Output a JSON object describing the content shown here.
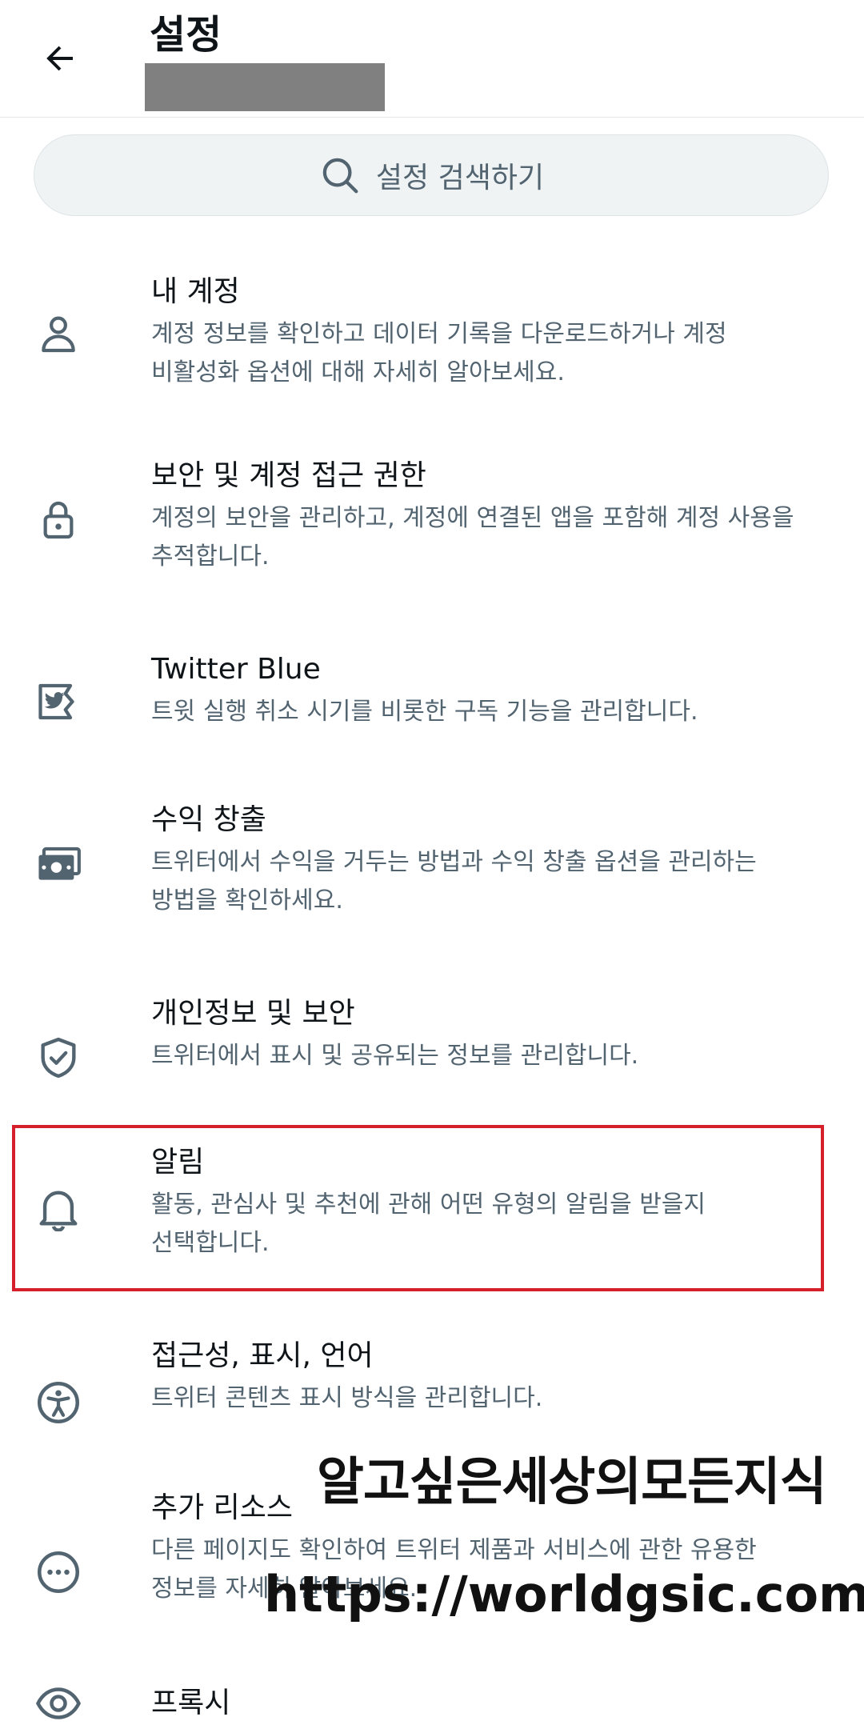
{
  "header": {
    "title": "설정",
    "back_icon": "arrow-left-icon"
  },
  "search": {
    "placeholder": "설정 검색하기",
    "icon": "search-icon"
  },
  "items": [
    {
      "icon": "person-icon",
      "title": "내 계정",
      "desc": [
        "계정 정보를 확인하고 데이터 기록을 다운로드하거나 계정",
        "비활성화 옵션에 대해 자세히 알아보세요."
      ]
    },
    {
      "icon": "lock-icon",
      "title": "보안 및 계정 접근 권한",
      "desc": [
        "계정의 보안을 관리하고, 계정에 연결된 앱을 포함해 계정 사용을",
        "추적합니다."
      ]
    },
    {
      "icon": "twitter-blue-icon",
      "title": "Twitter Blue",
      "desc": [
        "트윗 실행 취소 시기를 비롯한 구독 기능을 관리합니다."
      ]
    },
    {
      "icon": "money-icon",
      "title": "수익 창출",
      "desc": [
        "트위터에서 수익을 거두는 방법과 수익 창출 옵션을 관리하는",
        "방법을 확인하세요."
      ]
    },
    {
      "icon": "shield-check-icon",
      "title": "개인정보 및 보안",
      "desc": [
        "트위터에서 표시 및 공유되는 정보를 관리합니다."
      ]
    },
    {
      "icon": "bell-icon",
      "title": "알림",
      "desc": [
        "활동, 관심사 및 추천에 관해 어떤 유형의 알림을 받을지",
        "선택합니다."
      ]
    },
    {
      "icon": "accessibility-icon",
      "title": "접근성, 표시, 언어",
      "desc": [
        "트위터 콘텐츠 표시 방식을 관리합니다."
      ]
    },
    {
      "icon": "more-icon",
      "title": "추가 리소스",
      "desc": [
        "다른 페이지도 확인하여 트위터 제품과 서비스에 관한 유용한",
        "정보를 자세히 알아보세요."
      ]
    },
    {
      "icon": "eye-icon",
      "title": "프록시",
      "desc": []
    }
  ],
  "watermark": {
    "line1": "알고싶은세상의모든지식",
    "line2": "https://worldgsic.com"
  },
  "colors": {
    "text_primary": "#0f1419",
    "text_secondary": "#536471",
    "highlight_border": "#d5202b",
    "search_bg": "#eff3f4"
  }
}
